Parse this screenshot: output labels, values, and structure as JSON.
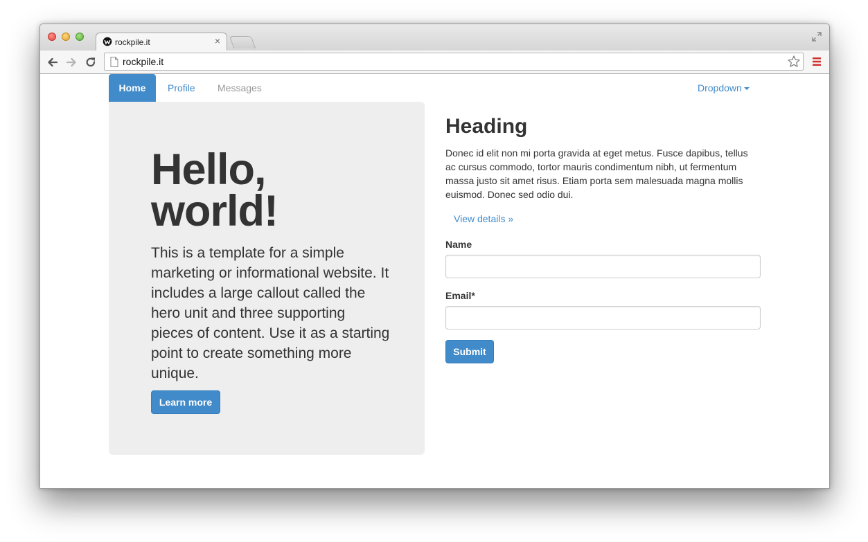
{
  "browser": {
    "tab_title": "rockpile.it",
    "tab_close": "×",
    "url": "rockpile.it",
    "icons": [
      "close-icon",
      "minimize-icon",
      "maximize-icon",
      "favicon-icon",
      "fullscreen-icon",
      "back-icon",
      "forward-icon",
      "reload-icon",
      "page-icon",
      "star-icon",
      "menu-icon"
    ]
  },
  "navbar": {
    "home": "Home",
    "profile": "Profile",
    "messages": "Messages",
    "dropdown": "Dropdown"
  },
  "hero": {
    "title": "Hello, world!",
    "text": "This is a template for a simple marketing or informational website. It includes a large callout called the hero unit and three supporting pieces of content. Use it as a starting point to create something more unique.",
    "button": "Learn more"
  },
  "side": {
    "heading": "Heading",
    "text": "Donec id elit non mi porta gravida at eget metus. Fusce dapibus, tellus ac cursus commodo, tortor mauris condimentum nibh, ut fermentum massa justo sit amet risus. Etiam porta sem malesuada magna mollis euismod. Donec sed odio dui.",
    "details_link": "View details »"
  },
  "form": {
    "name_label": "Name",
    "name_value": "",
    "email_label": "Email*",
    "email_value": "",
    "submit": "Submit"
  },
  "colors": {
    "primary": "#428bca",
    "jumbotron_bg": "#eeeeee",
    "text": "#333333",
    "muted": "#999999"
  }
}
